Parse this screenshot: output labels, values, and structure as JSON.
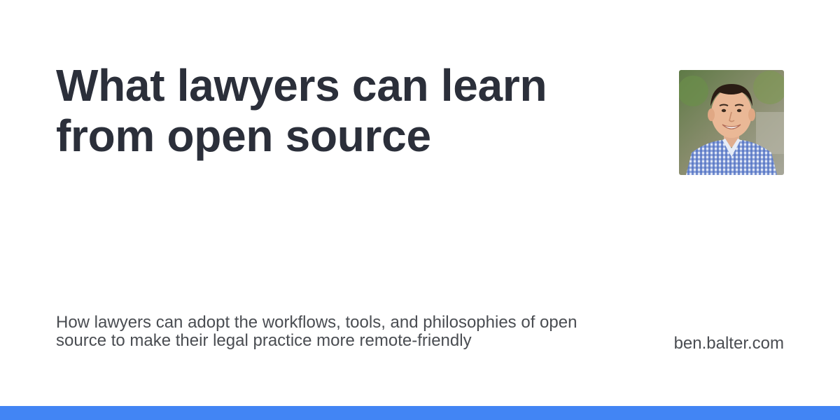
{
  "header": {
    "title": "What lawyers can learn from open source"
  },
  "main": {
    "description": "How lawyers can adopt the workflows, tools, and philosophies of open source to make their legal practice more remote-friendly"
  },
  "footer": {
    "site": "ben.balter.com"
  },
  "avatar": {
    "icon": "author-avatar"
  },
  "colors": {
    "accent": "#4285f4",
    "title": "#2b2f3a",
    "text": "#4a4d52",
    "background": "#ffffff"
  }
}
